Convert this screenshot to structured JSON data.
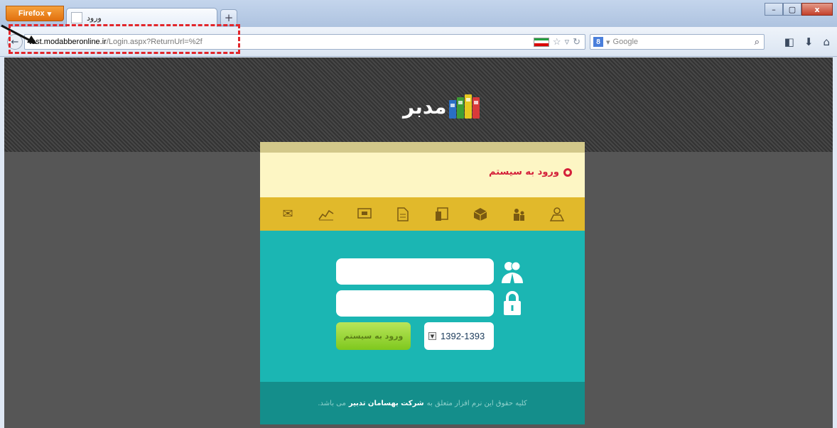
{
  "browser": {
    "app_button": "Firefox",
    "tab_title": "ورود",
    "new_tab": "+",
    "window_controls": {
      "minimize": "–",
      "maximize": "▢",
      "close": "x"
    },
    "url_host": "test.modabberonline.ir",
    "url_path": "/Login.aspx?ReturnUrl=%2f",
    "search_engine": "Google",
    "search_engine_badge": "8"
  },
  "page": {
    "logo_text": "مدبر",
    "book_colors": [
      "#d93a3a",
      "#e6c81f",
      "#3f9e35",
      "#2a6fc4"
    ],
    "panel_title": "ورود به سیستم",
    "toolbar_icons": [
      "mail-icon",
      "chart-icon",
      "monitor-icon",
      "document-icon",
      "report-icon",
      "box-icon",
      "people-icon",
      "person-icon"
    ],
    "login": {
      "username_value": "",
      "password_value": "",
      "fiscal_year": "1392-1393",
      "submit_label": "ورود به سیستم"
    },
    "footer": {
      "text_before": "کلیه حقوق این نرم افزار متعلق به",
      "company": "شرکت بهسامان تدبیر",
      "text_after": "می باشد."
    }
  },
  "colors": {
    "page_bg": "#565656",
    "panel_yellow": "#fdf6c4",
    "icon_strip": "#e1b92b",
    "login_teal": "#1bb6b3",
    "footer_teal": "#148e8b",
    "title_red": "#d4213b",
    "highlight": "#e2262b"
  }
}
